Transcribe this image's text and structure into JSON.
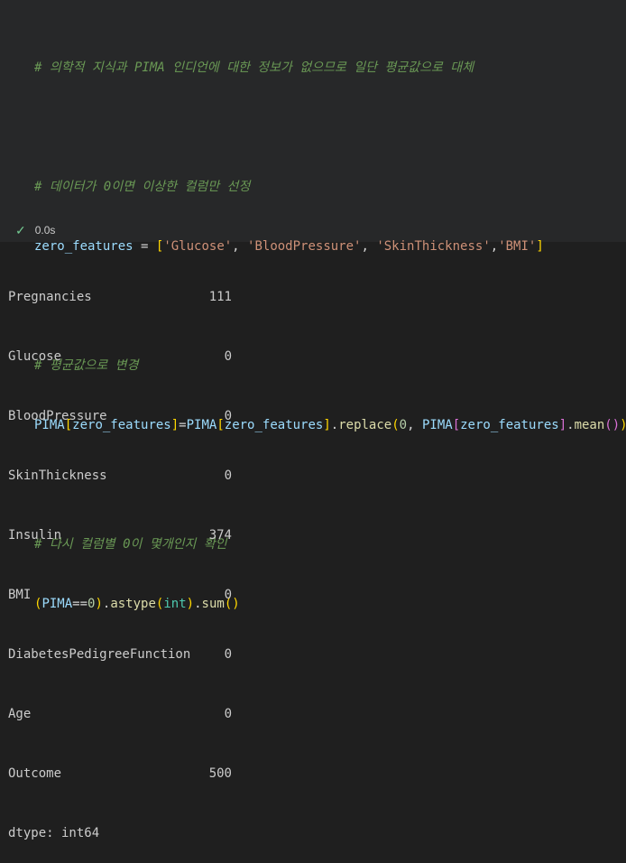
{
  "code": {
    "comment1": "# 의학적 지식과 PIMA 인디언에 대한 정보가 없으므로 일단 평균값으로 대체",
    "comment2": "# 데이터가 0이면 이상한 컬럼만 선정",
    "line2_var": "zero_features",
    "line2_op": " = ",
    "line2_open": "[",
    "features": [
      "'Glucose'",
      "'BloodPressure'",
      "'SkinThickness'",
      "'BMI'"
    ],
    "line2_close": "]",
    "comment3": "# 평균값으로 변경",
    "comment4": "# 다시 컬럼별 0이 몇개인지 확인",
    "df": "PIMA",
    "zero": "0",
    "replace_fn": "replace",
    "mean_fn": "mean",
    "astype_fn": "astype",
    "int_kw": "int",
    "sum_fn": "sum",
    "eqeq": "==",
    "dot": "."
  },
  "status": {
    "time": "0.0s"
  },
  "output": {
    "rows": [
      {
        "name": "Pregnancies",
        "value": "111"
      },
      {
        "name": "Glucose",
        "value": "0"
      },
      {
        "name": "BloodPressure",
        "value": "0"
      },
      {
        "name": "SkinThickness",
        "value": "0"
      },
      {
        "name": "Insulin",
        "value": "374"
      },
      {
        "name": "BMI",
        "value": "0"
      },
      {
        "name": "DiabetesPedigreeFunction",
        "value": "0"
      },
      {
        "name": "Age",
        "value": "0"
      },
      {
        "name": "Outcome",
        "value": "500"
      }
    ],
    "dtype": "dtype: int64"
  },
  "colors": {
    "cell_bg": "#272829",
    "output_bg": "#1f1f1f",
    "comment": "#6a9955",
    "string": "#ce9178",
    "variable": "#9cdcfe",
    "function": "#dcdcaa",
    "success": "#73c991"
  },
  "icons": {
    "status": "check-icon"
  }
}
